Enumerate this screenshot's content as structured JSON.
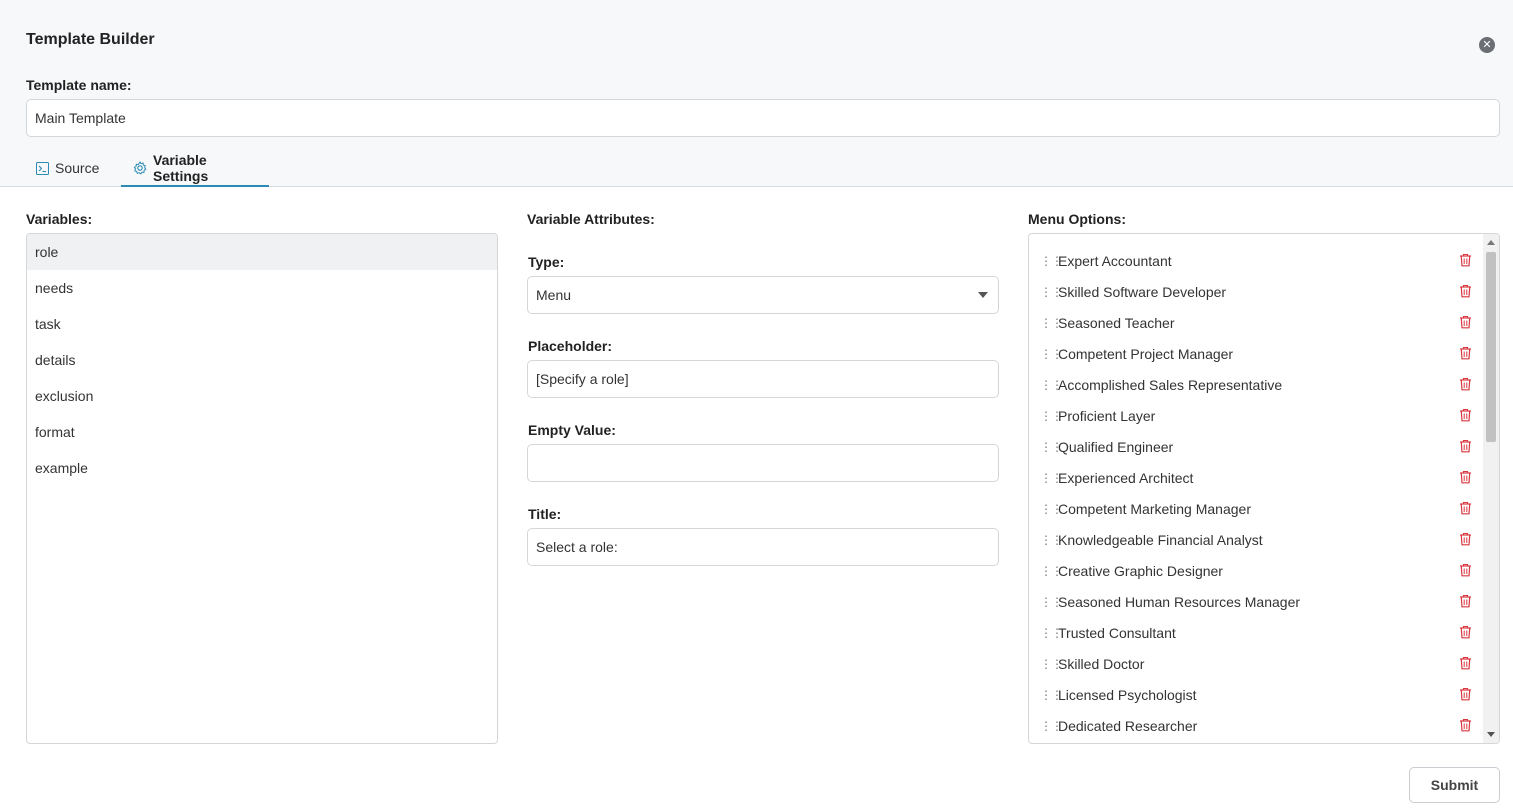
{
  "dialog": {
    "title": "Template Builder",
    "close_icon": "close-icon"
  },
  "template_name": {
    "label": "Template name:",
    "value": "Main Template"
  },
  "tabs": [
    {
      "label": "Source",
      "icon": "terminal-icon",
      "active": false
    },
    {
      "label": "Variable Settings",
      "icon": "gear-icon",
      "active": true
    }
  ],
  "variables": {
    "label": "Variables:",
    "items": [
      "role",
      "needs",
      "task",
      "details",
      "exclusion",
      "format",
      "example"
    ],
    "selected": "role"
  },
  "attributes": {
    "label": "Variable Attributes:",
    "type_label": "Type:",
    "type_value": "Menu",
    "placeholder_label": "Placeholder:",
    "placeholder_value": "[Specify a role]",
    "empty_label": "Empty Value:",
    "empty_value": "",
    "title_label": "Title:",
    "title_value": "Select a role:"
  },
  "menu_options": {
    "label": "Menu Options:",
    "items": [
      "Expert Accountant",
      "Skilled Software Developer",
      "Seasoned Teacher",
      "Competent Project Manager",
      "Accomplished Sales Representative",
      "Proficient Layer",
      "Qualified Engineer",
      "Experienced Architect",
      "Competent Marketing Manager",
      "Knowledgeable Financial Analyst",
      "Creative Graphic Designer",
      "Seasoned Human Resources Manager",
      "Trusted Consultant",
      "Skilled Doctor",
      "Licensed Psychologist",
      "Dedicated Researcher"
    ],
    "delete_color": "#d9363e"
  },
  "submit_label": "Submit",
  "colors": {
    "accent": "#2c8bb5",
    "header_bg": "#f7f8f9"
  }
}
